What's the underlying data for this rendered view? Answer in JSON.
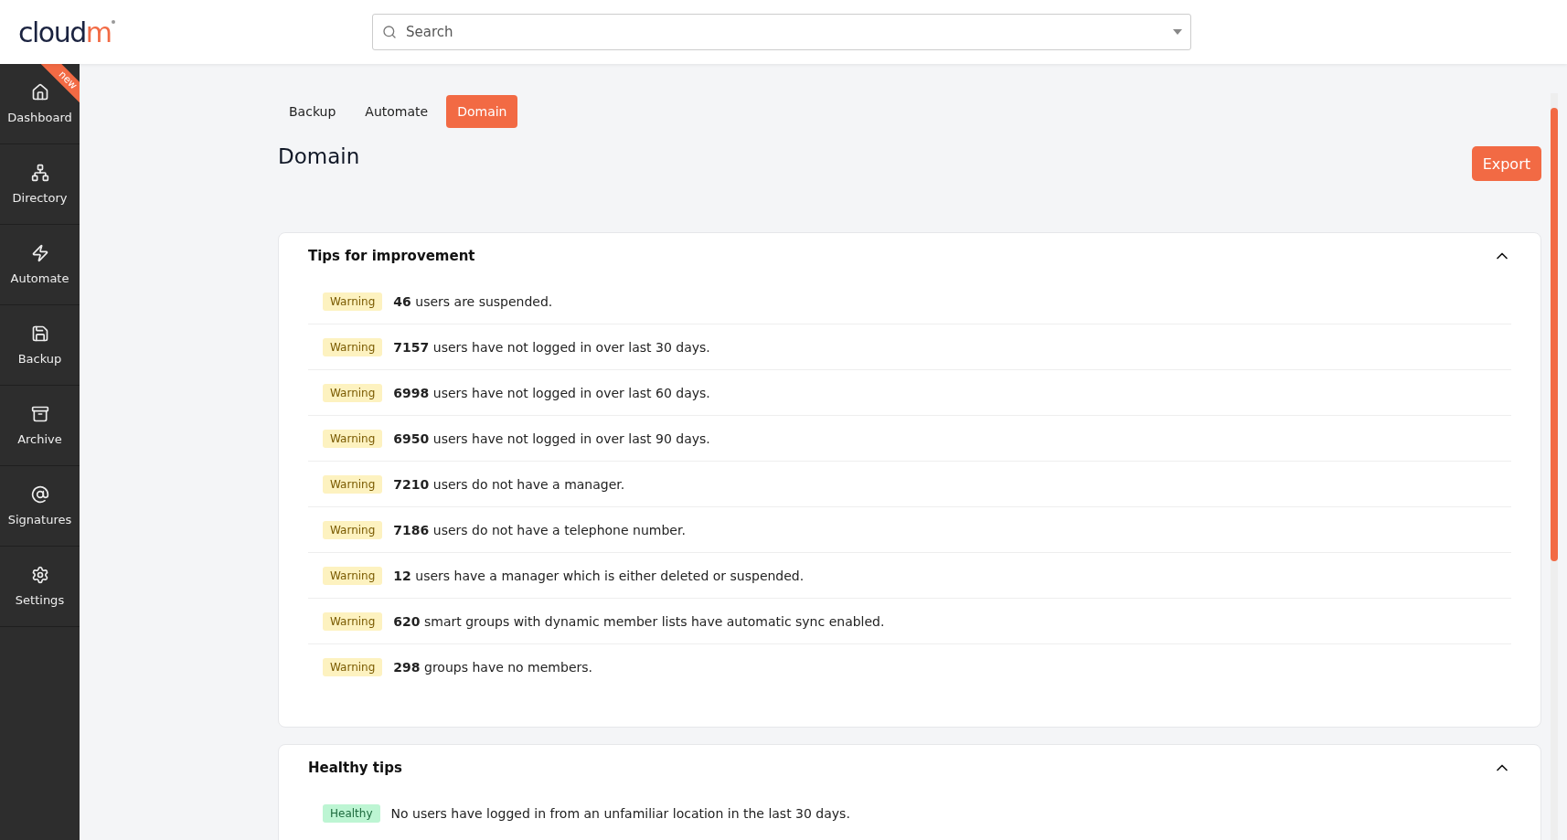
{
  "logo": {
    "text": "cloud",
    "accent": "m"
  },
  "search": {
    "placeholder": "Search"
  },
  "sidebar": {
    "items": [
      {
        "label": "Dashboard",
        "selected": false,
        "badge": "new"
      },
      {
        "label": "Directory",
        "selected": false
      },
      {
        "label": "Automate",
        "selected": false
      },
      {
        "label": "Backup",
        "selected": false
      },
      {
        "label": "Archive",
        "selected": false
      },
      {
        "label": "Signatures",
        "selected": false
      },
      {
        "label": "Settings",
        "selected": false
      }
    ]
  },
  "tabs": [
    {
      "label": "Backup",
      "selected": false
    },
    {
      "label": "Automate",
      "selected": false
    },
    {
      "label": "Domain",
      "selected": true
    }
  ],
  "page_title": "Domain",
  "export_button": "Export",
  "sections": [
    {
      "title": "Tips for improvement",
      "expanded": true,
      "items": [
        {
          "kind": "warning",
          "badge": "Warning",
          "text": "**46** users are suspended."
        },
        {
          "kind": "warning",
          "badge": "Warning",
          "text": "**7157** users have not logged in over last 30 days."
        },
        {
          "kind": "warning",
          "badge": "Warning",
          "text": "**6998** users have not logged in over last 60 days."
        },
        {
          "kind": "warning",
          "badge": "Warning",
          "text": "**6950** users have not logged in over last 90 days."
        },
        {
          "kind": "warning",
          "badge": "Warning",
          "text": "**7210** users do not have a manager."
        },
        {
          "kind": "warning",
          "badge": "Warning",
          "text": "**7186** users do not have a telephone number."
        },
        {
          "kind": "warning",
          "badge": "Warning",
          "text": "**12** users have a manager which is either deleted or suspended."
        },
        {
          "kind": "warning",
          "badge": "Warning",
          "text": "**620** smart groups with dynamic member lists have automatic sync enabled."
        },
        {
          "kind": "warning",
          "badge": "Warning",
          "text": "**298** groups have no members."
        }
      ]
    },
    {
      "title": "Healthy tips",
      "expanded": true,
      "items": [
        {
          "kind": "healthy",
          "badge": "Healthy",
          "text": "No users have logged in from an unfamiliar location in the last 30 days."
        }
      ]
    }
  ]
}
